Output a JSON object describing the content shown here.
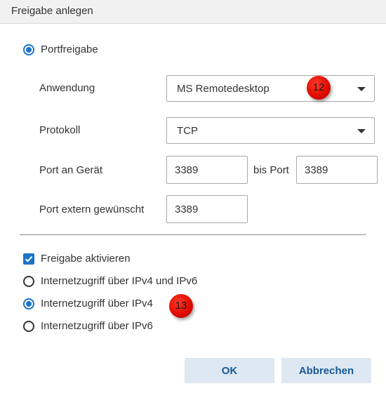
{
  "dialog": {
    "title": "Freigabe anlegen"
  },
  "share_type": {
    "label": "Portfreigabe",
    "selected": true
  },
  "form": {
    "application_label": "Anwendung",
    "application_value": "MS Remotedesktop",
    "protocol_label": "Protokoll",
    "protocol_value": "TCP",
    "port_device_label": "Port an Gerät",
    "port_device_from": "3389",
    "to_port_label": "bis Port",
    "port_device_to": "3389",
    "port_external_label": "Port extern gewünscht",
    "port_external_value": "3389"
  },
  "options": {
    "enable_label": "Freigabe aktivieren",
    "enable_checked": true,
    "access_options": [
      {
        "label": "Internetzugriff über IPv4 und IPv6",
        "selected": false
      },
      {
        "label": "Internetzugriff über IPv4",
        "selected": true
      },
      {
        "label": "Internetzugriff über IPv6",
        "selected": false
      }
    ]
  },
  "annotations": {
    "badge_12": "12",
    "badge_13": "13"
  },
  "buttons": {
    "ok": "OK",
    "cancel": "Abbrechen"
  },
  "colors": {
    "accent": "#1a73c8",
    "button_bg": "#dde8f3",
    "button_text": "#1a5a96",
    "badge": "#e00c00"
  }
}
